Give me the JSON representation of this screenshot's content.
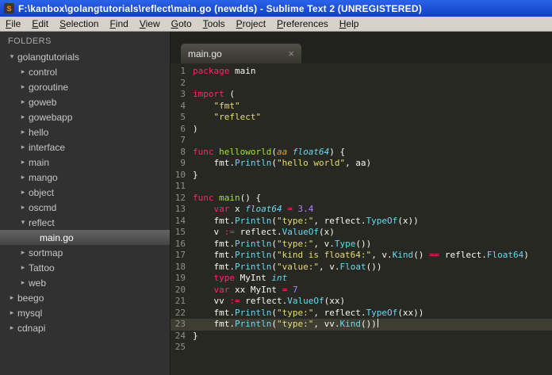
{
  "window": {
    "title": "F:\\kanbox\\golangtutorials\\reflect\\main.go (newdds) - Sublime Text 2 (UNREGISTERED)",
    "app_icon_glyph": "S"
  },
  "menu": {
    "items": [
      "File",
      "Edit",
      "Selection",
      "Find",
      "View",
      "Goto",
      "Tools",
      "Project",
      "Preferences",
      "Help"
    ]
  },
  "sidebar": {
    "header": "FOLDERS",
    "items": [
      {
        "label": "golangtutorials",
        "level": 0,
        "type": "folder",
        "expanded": true,
        "selected": false
      },
      {
        "label": "control",
        "level": 1,
        "type": "folder",
        "expanded": false,
        "selected": false
      },
      {
        "label": "goroutine",
        "level": 1,
        "type": "folder",
        "expanded": false,
        "selected": false
      },
      {
        "label": "goweb",
        "level": 1,
        "type": "folder",
        "expanded": false,
        "selected": false
      },
      {
        "label": "gowebapp",
        "level": 1,
        "type": "folder",
        "expanded": false,
        "selected": false
      },
      {
        "label": "hello",
        "level": 1,
        "type": "folder",
        "expanded": false,
        "selected": false
      },
      {
        "label": "interface",
        "level": 1,
        "type": "folder",
        "expanded": false,
        "selected": false
      },
      {
        "label": "main",
        "level": 1,
        "type": "folder",
        "expanded": false,
        "selected": false
      },
      {
        "label": "mango",
        "level": 1,
        "type": "folder",
        "expanded": false,
        "selected": false
      },
      {
        "label": "object",
        "level": 1,
        "type": "folder",
        "expanded": false,
        "selected": false
      },
      {
        "label": "oscmd",
        "level": 1,
        "type": "folder",
        "expanded": false,
        "selected": false
      },
      {
        "label": "reflect",
        "level": 1,
        "type": "folder",
        "expanded": true,
        "selected": false
      },
      {
        "label": "main.go",
        "level": 2,
        "type": "file",
        "expanded": false,
        "selected": true
      },
      {
        "label": "sortmap",
        "level": 1,
        "type": "folder",
        "expanded": false,
        "selected": false
      },
      {
        "label": "Tattoo",
        "level": 1,
        "type": "folder",
        "expanded": false,
        "selected": false
      },
      {
        "label": "web",
        "level": 1,
        "type": "folder",
        "expanded": false,
        "selected": false
      },
      {
        "label": "beego",
        "level": 0,
        "type": "folder",
        "expanded": false,
        "selected": false
      },
      {
        "label": "mysql",
        "level": 0,
        "type": "folder",
        "expanded": false,
        "selected": false
      },
      {
        "label": "cdnapi",
        "level": 0,
        "type": "folder",
        "expanded": false,
        "selected": false
      }
    ]
  },
  "tabbar": {
    "tabs": [
      {
        "label": "main.go",
        "active": true,
        "close_glyph": "×"
      }
    ]
  },
  "editor": {
    "language": "Go",
    "current_line": 23,
    "token_legend": {
      "k": "keyword",
      "s": "string",
      "f": "function-name",
      "t": "type",
      "c": "call",
      "n": "number",
      "o": "operator",
      "pa": "parameter",
      "p": "plain"
    },
    "lines": [
      [
        [
          "k",
          "package"
        ],
        [
          "p",
          " main"
        ]
      ],
      [],
      [
        [
          "k",
          "import"
        ],
        [
          "p",
          " ("
        ]
      ],
      [
        [
          "p",
          "    "
        ],
        [
          "s",
          "\"fmt\""
        ]
      ],
      [
        [
          "p",
          "    "
        ],
        [
          "s",
          "\"reflect\""
        ]
      ],
      [
        [
          "p",
          ")"
        ]
      ],
      [],
      [
        [
          "k",
          "func"
        ],
        [
          "p",
          " "
        ],
        [
          "f",
          "helloworld"
        ],
        [
          "p",
          "("
        ],
        [
          "pa",
          "aa"
        ],
        [
          "p",
          " "
        ],
        [
          "t",
          "float64"
        ],
        [
          "p",
          ") {"
        ]
      ],
      [
        [
          "p",
          "    fmt."
        ],
        [
          "c",
          "Println"
        ],
        [
          "p",
          "("
        ],
        [
          "s",
          "\"hello world\""
        ],
        [
          "p",
          ", aa)"
        ]
      ],
      [
        [
          "p",
          "}"
        ]
      ],
      [],
      [
        [
          "k",
          "func"
        ],
        [
          "p",
          " "
        ],
        [
          "f",
          "main"
        ],
        [
          "p",
          "() {"
        ]
      ],
      [
        [
          "p",
          "    "
        ],
        [
          "k",
          "var"
        ],
        [
          "p",
          " x "
        ],
        [
          "t",
          "float64"
        ],
        [
          "p",
          " "
        ],
        [
          "o",
          "="
        ],
        [
          "p",
          " "
        ],
        [
          "n",
          "3.4"
        ]
      ],
      [
        [
          "p",
          "    fmt."
        ],
        [
          "c",
          "Println"
        ],
        [
          "p",
          "("
        ],
        [
          "s",
          "\"type:\""
        ],
        [
          "p",
          ", reflect."
        ],
        [
          "c",
          "TypeOf"
        ],
        [
          "p",
          "(x))"
        ]
      ],
      [
        [
          "p",
          "    v "
        ],
        [
          "o",
          ":="
        ],
        [
          "p",
          " reflect."
        ],
        [
          "c",
          "ValueOf"
        ],
        [
          "p",
          "(x)"
        ]
      ],
      [
        [
          "p",
          "    fmt."
        ],
        [
          "c",
          "Println"
        ],
        [
          "p",
          "("
        ],
        [
          "s",
          "\"type:\""
        ],
        [
          "p",
          ", v."
        ],
        [
          "c",
          "Type"
        ],
        [
          "p",
          "())"
        ]
      ],
      [
        [
          "p",
          "    fmt."
        ],
        [
          "c",
          "Println"
        ],
        [
          "p",
          "("
        ],
        [
          "s",
          "\"kind is float64:\""
        ],
        [
          "p",
          ", v."
        ],
        [
          "c",
          "Kind"
        ],
        [
          "p",
          "() "
        ],
        [
          "o",
          "=="
        ],
        [
          "p",
          " reflect."
        ],
        [
          "c",
          "Float64"
        ],
        [
          "p",
          ")"
        ]
      ],
      [
        [
          "p",
          "    fmt."
        ],
        [
          "c",
          "Println"
        ],
        [
          "p",
          "("
        ],
        [
          "s",
          "\"value:\""
        ],
        [
          "p",
          ", v."
        ],
        [
          "c",
          "Float"
        ],
        [
          "p",
          "())"
        ]
      ],
      [
        [
          "p",
          "    "
        ],
        [
          "k",
          "type"
        ],
        [
          "p",
          " MyInt "
        ],
        [
          "t",
          "int"
        ]
      ],
      [
        [
          "p",
          "    "
        ],
        [
          "k",
          "var"
        ],
        [
          "p",
          " xx MyInt "
        ],
        [
          "o",
          "="
        ],
        [
          "p",
          " "
        ],
        [
          "n",
          "7"
        ]
      ],
      [
        [
          "p",
          "    vv "
        ],
        [
          "o",
          ":="
        ],
        [
          "p",
          " reflect."
        ],
        [
          "c",
          "ValueOf"
        ],
        [
          "p",
          "(xx)"
        ]
      ],
      [
        [
          "p",
          "    fmt."
        ],
        [
          "c",
          "Println"
        ],
        [
          "p",
          "("
        ],
        [
          "s",
          "\"type:\""
        ],
        [
          "p",
          ", reflect."
        ],
        [
          "c",
          "TypeOf"
        ],
        [
          "p",
          "(xx))"
        ]
      ],
      [
        [
          "p",
          "    fmt."
        ],
        [
          "c",
          "Println"
        ],
        [
          "p",
          "("
        ],
        [
          "s",
          "\"type:\""
        ],
        [
          "p",
          ", vv."
        ],
        [
          "c",
          "Kind"
        ],
        [
          "p",
          "())"
        ]
      ],
      [
        [
          "p",
          "}"
        ]
      ],
      []
    ]
  },
  "colors": {
    "titlebar_blue": "#1c4fd8",
    "menubar_bg": "#d6d2ca",
    "sidebar_bg": "#313131",
    "editor_bg": "#272822",
    "current_line_bg": "#3e3d32",
    "gutter_fg": "#8f908a",
    "keyword": "#f92672",
    "string": "#e6db74",
    "function_name": "#a6e22e",
    "type": "#66d9ef",
    "number": "#ae81ff",
    "parameter": "#fd971f",
    "plain_text": "#f8f8f2"
  }
}
